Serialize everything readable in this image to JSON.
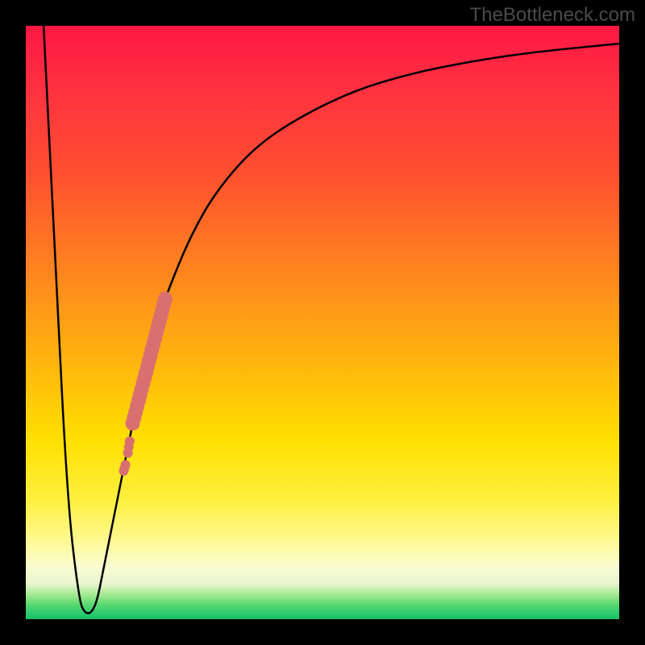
{
  "watermark": "TheBottleneck.com",
  "chart_data": {
    "type": "line",
    "title": "",
    "xlabel": "",
    "ylabel": "",
    "xlim": [
      0,
      100
    ],
    "ylim": [
      0,
      100
    ],
    "curve": {
      "name": "bottleneck-curve",
      "x": [
        3,
        5,
        7,
        9,
        10,
        11,
        12,
        13,
        15,
        18,
        20,
        22,
        25,
        28,
        32,
        38,
        45,
        55,
        65,
        75,
        85,
        95,
        100
      ],
      "y": [
        100,
        60,
        20,
        3,
        1,
        1,
        3,
        8,
        18,
        33,
        42,
        50,
        58,
        65,
        72,
        79,
        84,
        89,
        92,
        94,
        95.5,
        96.5,
        97
      ]
    },
    "highlight_points": {
      "name": "highlighted-range",
      "color": "#d97070",
      "segments": [
        {
          "x": [
            16.5,
            16.8
          ],
          "y": [
            25,
            26
          ],
          "radius": 6
        },
        {
          "x": [
            17.2,
            17.5
          ],
          "y": [
            28,
            30
          ],
          "radius": 6
        },
        {
          "x": [
            18.0,
            23.5
          ],
          "y": [
            33,
            54
          ],
          "radius": 9
        }
      ]
    },
    "background_gradient": {
      "stops": [
        {
          "pos": 0,
          "color": "#ff1744"
        },
        {
          "pos": 50,
          "color": "#ffb010"
        },
        {
          "pos": 80,
          "color": "#fff040"
        },
        {
          "pos": 100,
          "color": "#1abc60"
        }
      ]
    }
  }
}
